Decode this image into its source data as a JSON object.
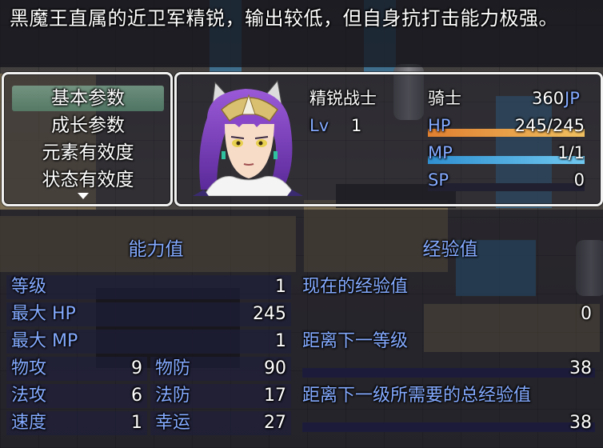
{
  "help": {
    "text": "黑魔王直属的近卫军精锐，输出较低，但自身抗打击能力极强。"
  },
  "menu": {
    "items": [
      "基本参数",
      "成长参数",
      "元素有效度",
      "状态有效度"
    ],
    "selected_index": 0
  },
  "actor": {
    "name": "精锐战士",
    "class": "骑士",
    "jp_value": "360",
    "jp_unit": "JP",
    "level_label": "Lv",
    "level": "1",
    "hp_label": "HP",
    "hp": "245/245",
    "hp_ratio": 1.0,
    "mp_label": "MP",
    "mp": "1/1",
    "mp_ratio": 1.0,
    "sp_label": "SP",
    "sp": "0",
    "sp_ratio": 0.0
  },
  "colors": {
    "system_blue": "#84aaff",
    "hp_gauge": [
      "#e08030",
      "#f0c060"
    ],
    "mp_gauge": [
      "#3090d0",
      "#70c8f0"
    ],
    "selected_row": "#6fa08a"
  },
  "stats": {
    "header": "能力值",
    "level": {
      "label": "等级",
      "value": "1"
    },
    "max_hp": {
      "label": "最大 HP",
      "value": "245"
    },
    "max_mp": {
      "label": "最大 MP",
      "value": "1"
    },
    "atk": {
      "label": "物攻",
      "value": "9"
    },
    "def": {
      "label": "物防",
      "value": "90"
    },
    "mat": {
      "label": "法攻",
      "value": "6"
    },
    "mdf": {
      "label": "法防",
      "value": "17"
    },
    "agi": {
      "label": "速度",
      "value": "1"
    },
    "luk": {
      "label": "幸运",
      "value": "27"
    }
  },
  "exp": {
    "header": "经验值",
    "current_label": "现在的经验值",
    "current_value": "0",
    "next_label": "距离下一等级",
    "next_value": "38",
    "total_label": "距离下一级所需要的总经验值",
    "total_value": "38"
  }
}
